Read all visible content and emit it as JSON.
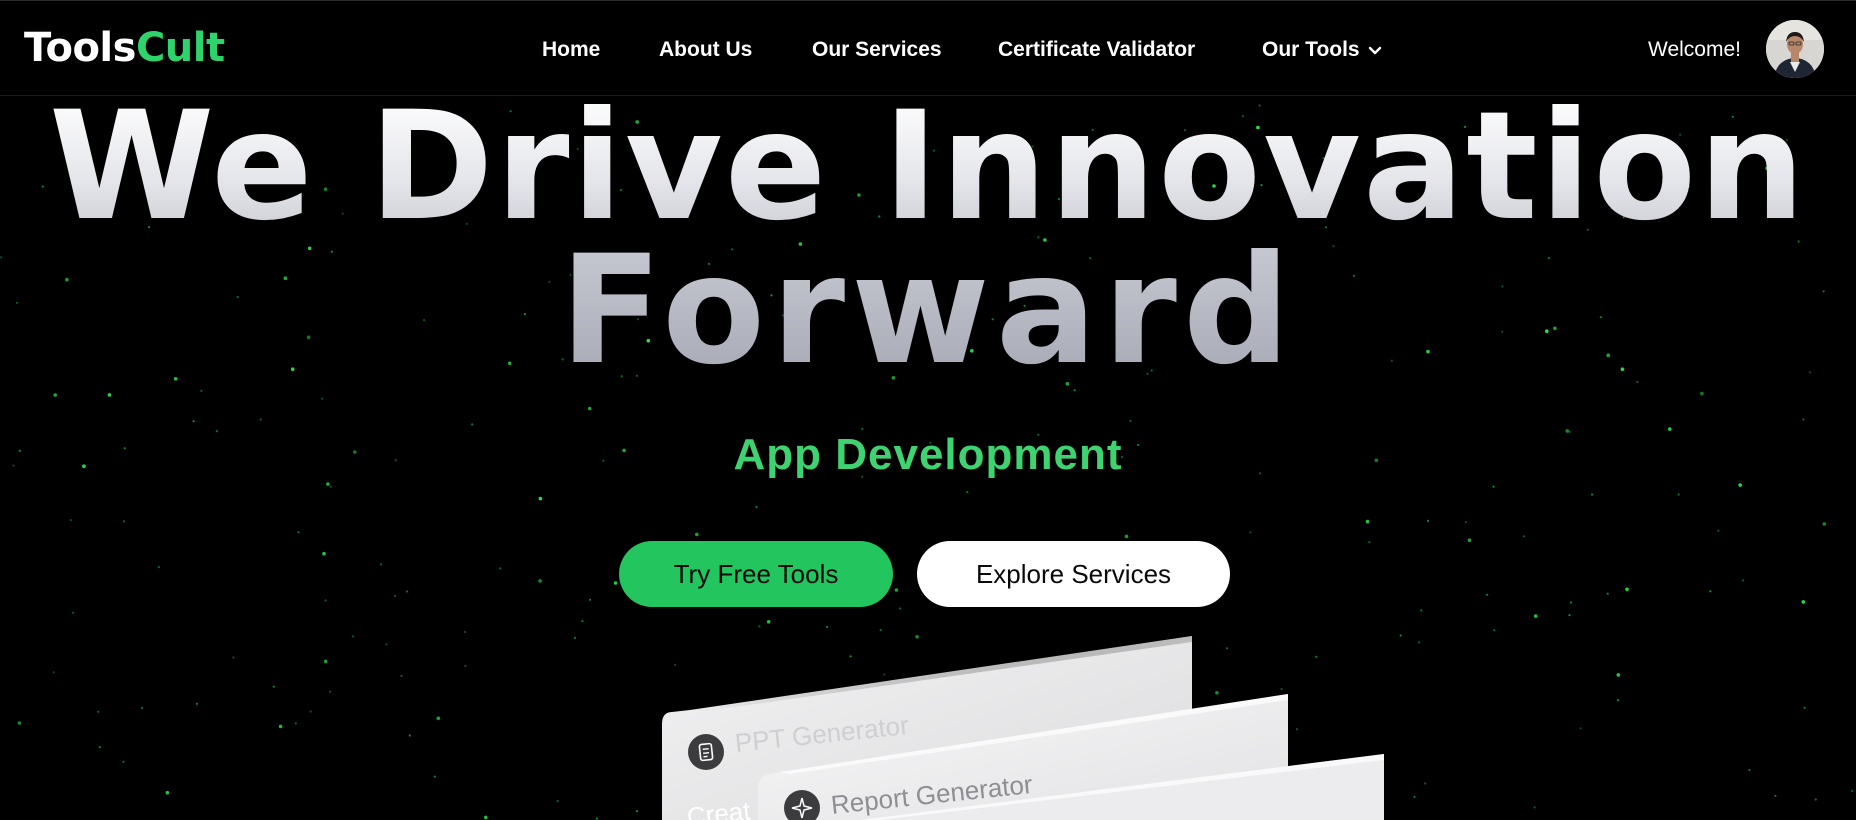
{
  "brand": {
    "logo_part1": "Tools",
    "logo_part2": "Cult",
    "accent_color": "#22c55e"
  },
  "nav": {
    "items": [
      {
        "label": "Home"
      },
      {
        "label": "About Us"
      },
      {
        "label": "Our Services"
      },
      {
        "label": "Certificate Validator"
      },
      {
        "label": "Our Tools",
        "icon": "chevron-down-icon"
      }
    ],
    "welcome_text": "Welcome!",
    "avatar_icon": "user-avatar"
  },
  "hero": {
    "title_line1": "We Drive Innovation",
    "title_line2": "Forward",
    "subtitle": "App Development",
    "primary_button": "Try Free Tools",
    "secondary_button": "Explore Services"
  },
  "cards": [
    {
      "title": "PPT Generator",
      "icon": "document-icon",
      "body_text": "Creat"
    },
    {
      "title": "Report Generator",
      "icon": "sparkle-icon"
    },
    {
      "title": "",
      "icon": ""
    }
  ]
}
